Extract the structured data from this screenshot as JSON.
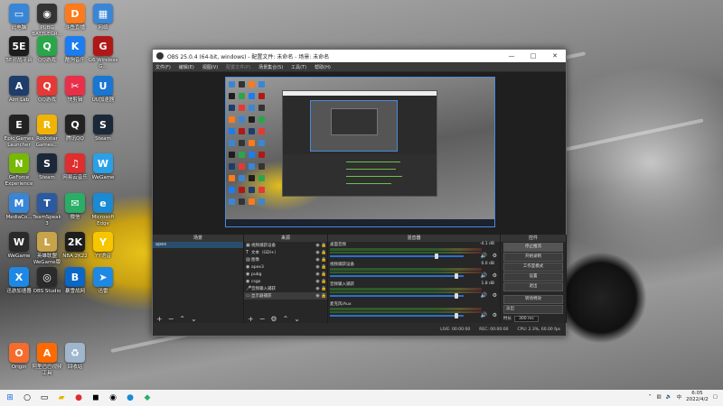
{
  "desktop": {
    "icons": [
      {
        "label": "此电脑",
        "icon": "computer-icon",
        "color": "#3a86d6",
        "glyph": "▭"
      },
      {
        "label": "PUBG BATTLEGR...",
        "icon": "pubg-icon",
        "color": "#333333",
        "glyph": "◉"
      },
      {
        "label": "斗鱼直播",
        "icon": "douyu-icon",
        "color": "#ff7a1a",
        "glyph": "D"
      },
      {
        "label": "网络",
        "icon": "network-icon",
        "color": "#3a86d6",
        "glyph": "▦"
      },
      {
        "label": "5E对战平台",
        "icon": "5e-icon",
        "color": "#1d1d1d",
        "glyph": "5E"
      },
      {
        "label": "QQ游戏",
        "icon": "qqgame-icon",
        "color": "#2aa64a",
        "glyph": "Q"
      },
      {
        "label": "酷狗音乐",
        "icon": "kugou-icon",
        "color": "#1b7df0",
        "glyph": "K"
      },
      {
        "label": "G6 Wireless G...",
        "icon": "g6-icon",
        "color": "#b01818",
        "glyph": "G"
      },
      {
        "label": "Aim Lab",
        "icon": "aimlab-icon",
        "color": "#1e3d6b",
        "glyph": "A"
      },
      {
        "label": "QQ游戏",
        "icon": "qqgame2-icon",
        "color": "#e53935",
        "glyph": "Q"
      },
      {
        "label": "快剪辑",
        "icon": "kuaijianji-icon",
        "color": "#e8304a",
        "glyph": "✂"
      },
      {
        "label": "UU加速器",
        "icon": "uu-icon",
        "color": "#1976d2",
        "glyph": "U"
      },
      {
        "label": "Epic Games Launcher",
        "icon": "epic-icon",
        "color": "#222222",
        "glyph": "E"
      },
      {
        "label": "Rockstar Games...",
        "icon": "rockstar-icon",
        "color": "#f0b400",
        "glyph": "R"
      },
      {
        "label": "腾讯QQ",
        "icon": "qq-icon",
        "color": "#222222",
        "glyph": "Q"
      },
      {
        "label": "Steam",
        "icon": "steam-icon",
        "color": "#1b2838",
        "glyph": "S"
      },
      {
        "label": "GeForce Experience",
        "icon": "geforce-icon",
        "color": "#76b900",
        "glyph": "N"
      },
      {
        "label": "Steam",
        "icon": "steam2-icon",
        "color": "#1b2838",
        "glyph": "S"
      },
      {
        "label": "网易云音乐",
        "icon": "netease-icon",
        "color": "#e02d2d",
        "glyph": "♫"
      },
      {
        "label": "WeGame",
        "icon": "wegame-icon",
        "color": "#2aa0e8",
        "glyph": "W"
      },
      {
        "label": "MediaCo...",
        "icon": "mediacoder-icon",
        "color": "#3a86d6",
        "glyph": "M"
      },
      {
        "label": "TeamSpeak 3",
        "icon": "teamspeak-icon",
        "color": "#2c5aa0",
        "glyph": "T"
      },
      {
        "label": "微信",
        "icon": "wechat-icon",
        "color": "#2aae67",
        "glyph": "✉"
      },
      {
        "label": "Microsoft Edge",
        "icon": "edge-icon",
        "color": "#1a8ad4",
        "glyph": "e"
      },
      {
        "label": "WeGame",
        "icon": "wegame2-icon",
        "color": "#2a2a2a",
        "glyph": "W"
      },
      {
        "label": "英雄联盟WeGame版",
        "icon": "lol-icon",
        "color": "#c8a34a",
        "glyph": "L"
      },
      {
        "label": "NBA 2K22",
        "icon": "nba-icon",
        "color": "#1d1d1d",
        "glyph": "2K"
      },
      {
        "label": "YY语音",
        "icon": "yy-icon",
        "color": "#f7c600",
        "glyph": "Y"
      },
      {
        "label": "迅游加速器",
        "icon": "xunyou-icon",
        "color": "#1e88e5",
        "glyph": "X"
      },
      {
        "label": "OBS Studio",
        "icon": "obs-icon",
        "color": "#2b2b2b",
        "glyph": "◎"
      },
      {
        "label": "暴雪战网",
        "icon": "battlenet-icon",
        "color": "#0a67c8",
        "glyph": "B"
      },
      {
        "label": "迅雷",
        "icon": "xunlei-icon",
        "color": "#1e88e5",
        "glyph": "➤"
      },
      {
        "label": "Origin",
        "icon": "origin-icon",
        "color": "#f56c2d",
        "glyph": "O"
      },
      {
        "label": "阿里巴巴视频工具",
        "icon": "ali-icon",
        "color": "#ff6a00",
        "glyph": "A"
      },
      {
        "label": "回收站",
        "icon": "recycle-icon",
        "color": "#9fb6cc",
        "glyph": "♻"
      }
    ]
  },
  "obs": {
    "title": "OBS 25.0.4 (64-bit, windows) - 配置文件: 未命名 - 场景: 未命名",
    "controls": {
      "min": "—",
      "max": "□",
      "close": "✕"
    },
    "menu": [
      "文件(F)",
      "编辑(E)",
      "视图(V)",
      "配置文件(P)",
      "场景集合(S)",
      "工具(T)",
      "帮助(H)"
    ],
    "docks": {
      "scenes": {
        "title": "场景",
        "items": [
          "apex"
        ]
      },
      "sources": {
        "title": "来源",
        "items": [
          {
            "name": "视频捕获设备",
            "icon": "camera-icon",
            "glyph": "▣"
          },
          {
            "name": "文本（GDI+）",
            "icon": "text-icon",
            "glyph": "T"
          },
          {
            "name": "图像",
            "icon": "image-icon",
            "glyph": "▨"
          },
          {
            "name": "apex3",
            "icon": "game-capture-icon",
            "glyph": "◉"
          },
          {
            "name": "pubg",
            "icon": "game-capture-icon",
            "glyph": "◉"
          },
          {
            "name": "csgo",
            "icon": "game-capture-icon",
            "glyph": "◉"
          },
          {
            "name": "音频输入捕获",
            "icon": "mic-icon",
            "glyph": "🎤"
          },
          {
            "name": "显示器捕获",
            "icon": "monitor-icon",
            "glyph": "▭"
          }
        ]
      },
      "mixer": {
        "title": "混音器",
        "channels": [
          {
            "name": "桌面音频",
            "db": "-4.1 dB"
          },
          {
            "name": "视频捕获设备",
            "db": "0.0 dB"
          },
          {
            "name": "音频输入捕获",
            "db": "1.8 dB"
          },
          {
            "name": "麦克风/Aux",
            "db": ""
          }
        ]
      },
      "transitions": {
        "title": "控件",
        "type": "淡出",
        "duration_label": "时长",
        "duration": "300 ms"
      },
      "controls": {
        "title": "控件",
        "buttons": [
          "停止推流",
          "开始录制",
          "工作室模式",
          "设置",
          "退出"
        ],
        "extra": "转场特效"
      }
    },
    "status": {
      "live": "LIVE: 00:00:00",
      "rec": "REC: 00:00:00",
      "cpu": "CPU: 2.3%, 60.00 fps"
    }
  },
  "taskbar": {
    "time": "6:05",
    "date": "2022/4/2",
    "input": "中"
  }
}
